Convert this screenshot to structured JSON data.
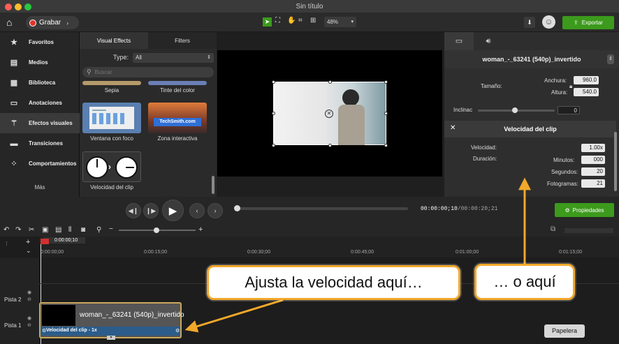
{
  "window": {
    "title": "Sin título"
  },
  "toolbar": {
    "record_label": "Grabar",
    "zoom": "48%",
    "export_label": "Exportar"
  },
  "sidebar": {
    "items": [
      {
        "label": "Favoritos",
        "icon": "star-icon"
      },
      {
        "label": "Medios",
        "icon": "film-icon"
      },
      {
        "label": "Biblioteca",
        "icon": "library-icon"
      },
      {
        "label": "Anotaciones",
        "icon": "annotation-icon"
      },
      {
        "label": "Efectos visuales",
        "icon": "wand-icon"
      },
      {
        "label": "Transiciones",
        "icon": "transition-icon"
      },
      {
        "label": "Comportamientos",
        "icon": "behavior-icon"
      }
    ],
    "more": "Más"
  },
  "effects_panel": {
    "tabs": [
      "Visual Effects",
      "Filters"
    ],
    "type_label": "Type:",
    "type_value": "All",
    "search_placeholder": "Buscar",
    "items": [
      "Sepia",
      "Tinte del color",
      "Ventana con foco",
      "Zona interactiva",
      "Velocidad del clip"
    ],
    "zone_thumb_text": "TechSmith.com"
  },
  "properties": {
    "clip_name": "woman_-_63241 (540p)_invertido",
    "size_label": "Tamaño:",
    "width_label": "Anchura:",
    "width_value": "960.0",
    "height_label": "Altura:",
    "height_value": "540.0",
    "tilt_label": "Inclinac",
    "tilt_value": "0",
    "speed_section_title": "Velocidad del clip",
    "speed_label": "Velocidad:",
    "speed_value": "1.00x",
    "duration_label": "Duración:",
    "minutes_label": "Minutos:",
    "minutes_value": "000",
    "seconds_label": "Segundos:",
    "seconds_value": "20",
    "frames_label": "Fotogramas:",
    "frames_value": "21",
    "properties_button": "Propiedades"
  },
  "playback": {
    "timecode_current": "00:00:00;10",
    "timecode_total": "/00:00:20;21",
    "playhead_progress": 0.0
  },
  "timeline": {
    "playhead_time": "0:00:00;10",
    "ruler": [
      "0:00:00;00",
      "0:00:15;00",
      "0:00:30;00",
      "0:00:45;00",
      "0:01:00;00",
      "0:01:15;00"
    ],
    "tracks": [
      "Pista 2",
      "Pista 1"
    ],
    "clip_title": "woman_-_63241 (540p)_invertido",
    "clip_effect": "Velocidad del clip - 1x",
    "trash_label": "Papelera"
  },
  "callouts": {
    "left": "Ajusta la velocidad aquí…",
    "right": "… o aquí"
  },
  "colors": {
    "accent_green": "#3c9a1c",
    "callout_border": "#f2a82a",
    "record_red": "#e0332b"
  }
}
